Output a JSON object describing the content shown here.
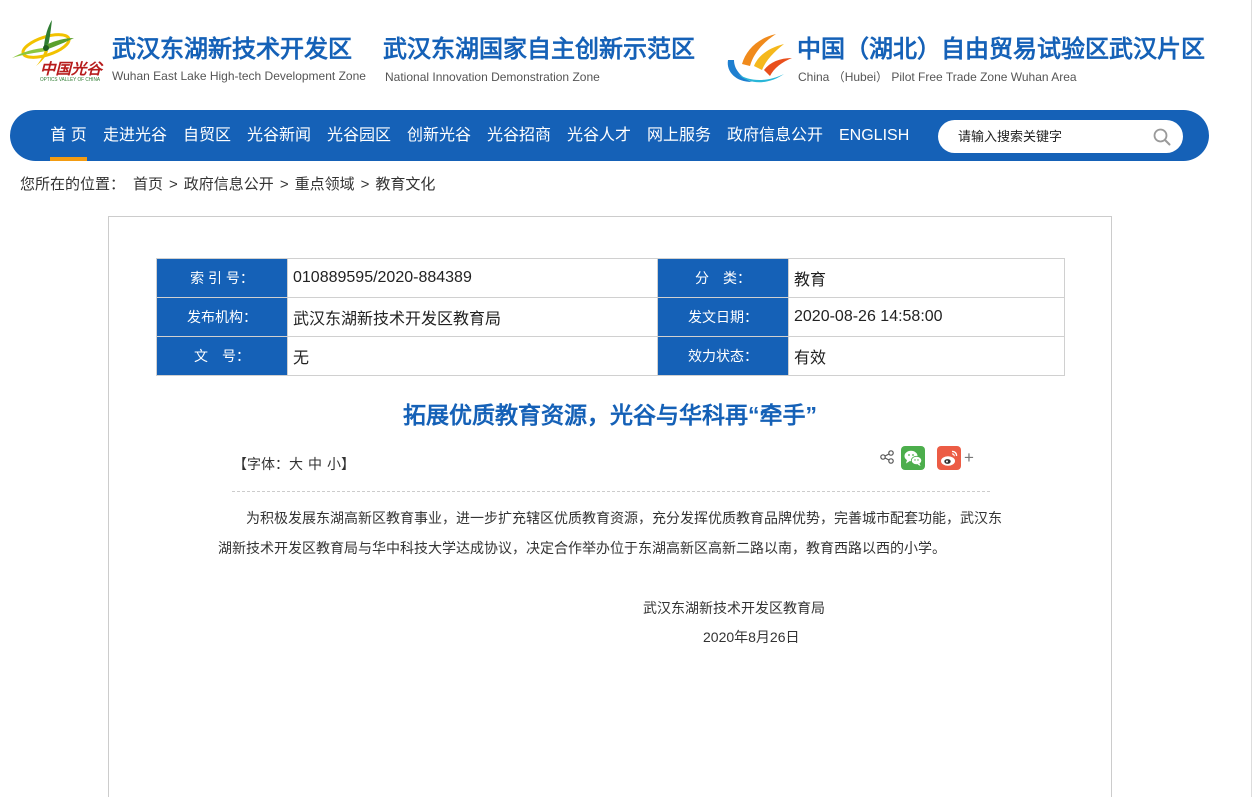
{
  "header": {
    "logo": {
      "text": "中国光谷",
      "subtext": "OPTICS VALLEY OF CHINA"
    },
    "brands": [
      {
        "title": "武汉东湖新技术开发区",
        "subtitle": "Wuhan East Lake High-tech Development Zone"
      },
      {
        "title": "武汉东湖国家自主创新示范区",
        "subtitle": "National Innovation Demonstration Zone"
      },
      {
        "title": "中国（湖北）自由贸易试验区武汉片区",
        "subtitle": "China （Hubei） Pilot Free Trade Zone Wuhan Area"
      }
    ]
  },
  "nav": {
    "items": [
      {
        "label": "首 页",
        "active": true
      },
      {
        "label": "走进光谷",
        "active": false
      },
      {
        "label": "自贸区",
        "active": false
      },
      {
        "label": "光谷新闻",
        "active": false
      },
      {
        "label": "光谷园区",
        "active": false
      },
      {
        "label": "创新光谷",
        "active": false
      },
      {
        "label": "光谷招商",
        "active": false
      },
      {
        "label": "光谷人才",
        "active": false
      },
      {
        "label": "网上服务",
        "active": false
      },
      {
        "label": "政府信息公开",
        "active": false
      },
      {
        "label": "ENGLISH",
        "active": false
      }
    ],
    "search": {
      "placeholder": "请输入搜索关键字",
      "value": "",
      "icon": "search-icon"
    }
  },
  "breadcrumb": {
    "prefix": "您所在的位置：",
    "separator": ">",
    "items": [
      "首页",
      "政府信息公开",
      "重点领域",
      "教育文化"
    ]
  },
  "info_table": {
    "index_no": {
      "label": "索 引 号：",
      "value": "010889595/2020-884389"
    },
    "category": {
      "label": "分　类：",
      "value": "教育"
    },
    "publisher": {
      "label": "发布机构：",
      "value": "武汉东湖新技术开发区教育局"
    },
    "issue_date": {
      "label": "发文日期：",
      "value": "2020-08-26 14:58:00"
    },
    "doc_no": {
      "label": "文　号：",
      "value": "无"
    },
    "status": {
      "label": "效力状态：",
      "value": "有效"
    }
  },
  "article": {
    "title": "拓展优质教育资源，光谷与华科再“牵手”",
    "font_size_control": {
      "prefix": "【字体：",
      "large": "大",
      "medium": "中",
      "small": "小",
      "suffix": "】"
    },
    "share": {
      "icons": [
        "share-icon",
        "wechat-icon",
        "weibo-icon"
      ],
      "more_label": "+"
    },
    "body": "为积极发展东湖高新区教育事业，进一步扩充辖区优质教育资源，充分发挥优质教育品牌优势，完善城市配套功能，武汉东湖新技术开发区教育局与华中科技大学达成协议，决定合作举办位于东湖高新区高新二路以南，教育西路以西的小学。",
    "signature": {
      "organization": "武汉东湖新技术开发区教育局",
      "date": "2020年8月26日"
    }
  },
  "colors": {
    "primary": "#1561b7",
    "accent": "#f39c12",
    "text": "#333333",
    "border": "#cccccc",
    "wechat": "#4cae4c",
    "weibo": "#ec5c45"
  }
}
